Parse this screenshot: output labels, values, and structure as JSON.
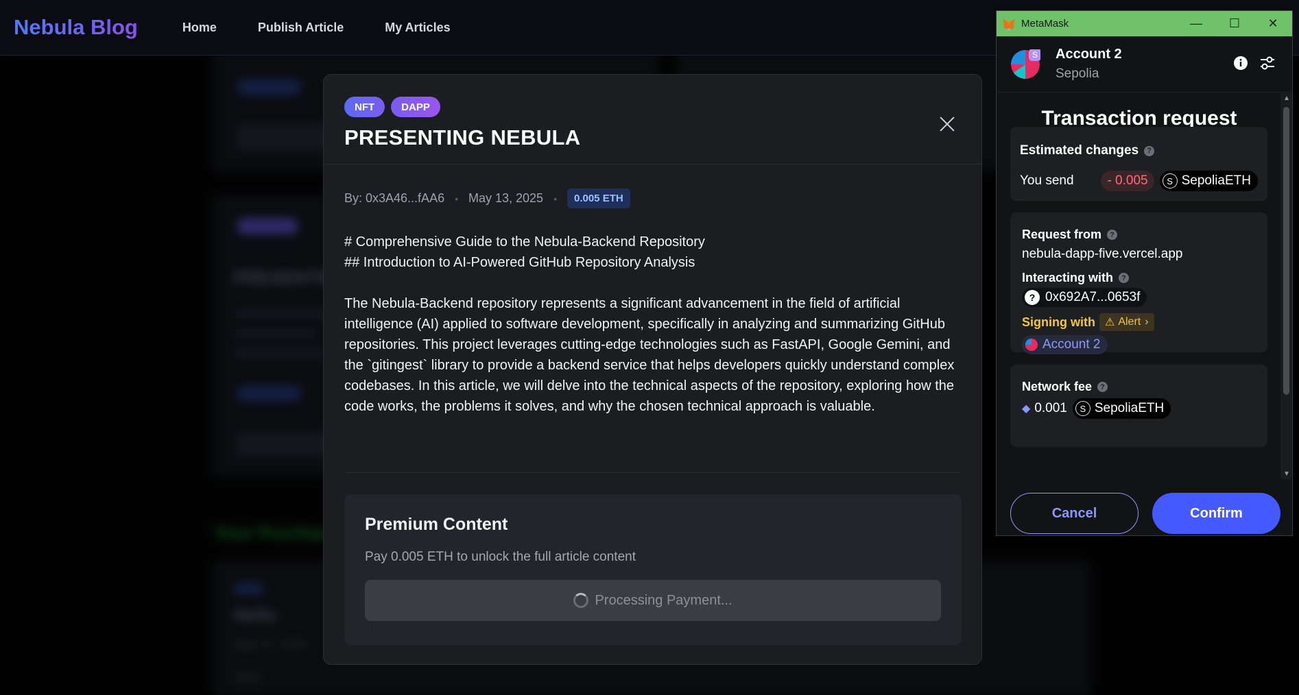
{
  "header": {
    "brand": "Nebula Blog",
    "nav": [
      "Home",
      "Publish Article",
      "My Articles"
    ]
  },
  "modal": {
    "tags": [
      "NFT",
      "DAPP"
    ],
    "title": "PRESENTING NEBULA",
    "author": "By: 0x3A46...fAA6",
    "date": "May 13, 2025",
    "price_badge": "0.005 ETH",
    "heading_line_1": "# Comprehensive Guide to the Nebula-Backend Repository",
    "heading_line_2": "## Introduction to AI-Powered GitHub Repository Analysis",
    "paragraph": "The Nebula-Backend repository represents a significant advancement in the field of artificial intelligence (AI) applied to software development, specifically in analyzing and summarizing GitHub repositories. This project leverages cutting-edge technologies such as FastAPI, Google Gemini, and the `gitingest` library to provide a backend service that helps developers quickly understand complex codebases. In this article, we will delve into the technical aspects of the repository, exploring how the code works, the problems it solves, and why the chosen technical approach is valuable.",
    "premium_title": "Premium Content",
    "premium_desc": "Pay 0.005 ETH to unlock the full article content",
    "pay_button": "Processing Payment..."
  },
  "background": {
    "purchases_heading": "Your Purchases",
    "card_title_1": "PRESENTIN",
    "card_title_2": "Hello",
    "card_date_2": "May 11, 2025",
    "card_text_2": "Hello"
  },
  "metamask": {
    "window_title": "MetaMask",
    "account_name": "Account 2",
    "network": "Sepolia",
    "tx_title": "Transaction request",
    "estimated_label": "Estimated changes",
    "you_send_label": "You send",
    "send_amount": "- 0.005",
    "send_token": "SepoliaETH",
    "request_from_label": "Request from",
    "request_from_value": "nebula-dapp-five.vercel.app",
    "interacting_label": "Interacting with",
    "interacting_value": "0x692A7...0653f",
    "signing_label": "Signing with",
    "alert_label": "Alert",
    "signing_account": "Account 2",
    "network_fee_label": "Network fee",
    "network_fee_value": "0.001",
    "network_fee_token": "SepoliaETH",
    "cancel": "Cancel",
    "confirm": "Confirm"
  },
  "colors": {
    "accent": "#4459ff",
    "brand_start": "#4f7cf5",
    "brand_end": "#8a4ff0",
    "titlebar": "#6fc26a",
    "alert": "#f3c63f"
  }
}
